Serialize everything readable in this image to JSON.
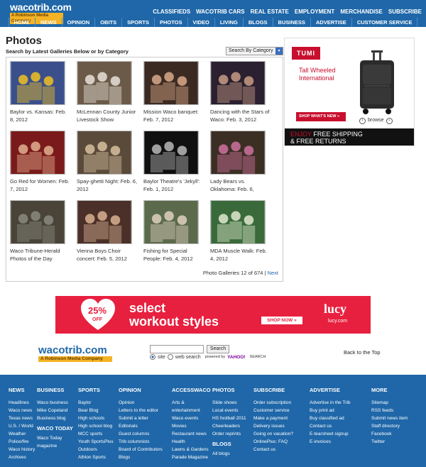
{
  "header": {
    "logo_text": "wacotrib.com",
    "logo_sub": "A Robinson Media Company",
    "top_links": [
      "CLASSIFIEDS",
      "WACOTRIB CARS",
      "REAL ESTATE",
      "EMPLOYMENT",
      "MERCHANDISE",
      "SUBSCRIBE"
    ],
    "nav": [
      "HOME",
      "NEWS",
      "OPINION",
      "OBITS",
      "SPORTS",
      "PHOTOS",
      "VIDEO",
      "LIVING",
      "BLOGS",
      "BUSINESS",
      "ADVERTISE",
      "CUSTOMER SERVICE"
    ]
  },
  "photos": {
    "title": "Photos",
    "subtitle": "Search by Latest Galleries Below or by Category",
    "category_select": "Search By Category",
    "galleries": [
      {
        "caption": "Baylor vs. Kansas: Feb. 8, 2012",
        "thumb_bg": "#3a4f8c",
        "thumb_fg": "#f0c020"
      },
      {
        "caption": "McLennan County Junior Livestock Show",
        "thumb_bg": "#6b5a48",
        "thumb_fg": "#e8e2da"
      },
      {
        "caption": "Mission Waco banquet: Feb. 7, 2012",
        "thumb_bg": "#3a2a22",
        "thumb_fg": "#d9a98a"
      },
      {
        "caption": "Dancing with the Stars of Waco: Feb. 3, 2012",
        "thumb_bg": "#2a2030",
        "thumb_fg": "#c89c84"
      },
      {
        "caption": "Go Red for Women: Feb. 7, 2012",
        "thumb_bg": "#7a1a1a",
        "thumb_fg": "#e0b090"
      },
      {
        "caption": "Spay-ghetti Night: Feb. 6, 2012",
        "thumb_bg": "#5a4a3a",
        "thumb_fg": "#d8c0a0"
      },
      {
        "caption": "Baylor Theatre's 'Jekyll': Feb. 1, 2012",
        "thumb_bg": "#101010",
        "thumb_fg": "#b8b8b8"
      },
      {
        "caption": "Lady Bears vs. Oklahoma: Feb. 6,",
        "thumb_bg": "#3b2f24",
        "thumb_fg": "#d070a0"
      },
      {
        "caption": "Waco Tribune-Herald Photos of the Day",
        "thumb_bg": "#4a4438",
        "thumb_fg": "#8a8a80"
      },
      {
        "caption": "Vienna Boys Choir concert: Feb. 5, 2012",
        "thumb_bg": "#4a3028",
        "thumb_fg": "#d8b090"
      },
      {
        "caption": "Fishing for Special People: Feb. 4, 2012",
        "thumb_bg": "#5a6a4a",
        "thumb_fg": "#e0d0c0"
      },
      {
        "caption": "MDA Muscle Walk: Feb. 4, 2012",
        "thumb_bg": "#3a6a3a",
        "thumb_fg": "#e0e8d0"
      }
    ],
    "count_text": "Photo Galleries 12 of 674 |",
    "next_label": "Next"
  },
  "ad_tumi": {
    "logo": "TUMI",
    "headline": "Tall Wheeled International",
    "button": "SHOP WHAT'S NEW »",
    "browse": "browse",
    "bar_enjoy": "ENJOY",
    "bar_line1": " FREE SHIPPING",
    "bar_line2": "& FREE RETURNS"
  },
  "ad_lucy": {
    "badge_pct": "25%",
    "badge_off": "OFF",
    "headline_1": "select",
    "headline_2": "workout styles",
    "button": "SHOP NOW »",
    "brand": "lucy",
    "url": "lucy.com"
  },
  "search": {
    "logo_text": "wacotrib.com",
    "logo_sub": "A Robinson Media Company",
    "button": "Search",
    "opt_site": "site",
    "opt_web": "web search",
    "powered": "powered by",
    "yahoo": "YAHOO!",
    "search_word": "SEARCH",
    "back_to_top": "Back to the Top"
  },
  "footer": {
    "columns": [
      {
        "heading": "NEWS",
        "links": [
          "Headlines",
          "Waco news",
          "Texas news",
          "U.S. / World",
          "Weather",
          "Police/fire",
          "Waco history",
          "Archives"
        ]
      },
      {
        "heading": "BUSINESS",
        "links": [
          "Waco business",
          "Mike Copeland",
          "Business blog"
        ],
        "heading2": "WACO TODAY",
        "links2": [
          "Waco Today",
          "magazine"
        ]
      },
      {
        "heading": "SPORTS",
        "links": [
          "Baylor",
          "Bear Blog",
          "High schools",
          "High school blog",
          "MCC sports",
          "Youth SportsPlus",
          "Outdoors",
          "Athlon Sports"
        ]
      },
      {
        "heading": "OPINION",
        "links": [
          "Opinion",
          "Letters to the editor",
          "Submit a letter",
          "Editorials",
          "Guest columns",
          "Trib columnists",
          "Board of Contributors",
          "Blogs"
        ]
      },
      {
        "heading": "ACCESSWACO",
        "links": [
          "Arts &",
          "entertainment",
          "Waco events",
          "Movies",
          "Restaurant news",
          "Health",
          "Lawns & Gardens",
          "Parade Magazine"
        ]
      },
      {
        "heading": "PHOTOS",
        "links": [
          "Slide shows",
          "Local events",
          "HS football 2011",
          "Cheerleaders",
          "Order reprints"
        ],
        "heading2": "BLOGS",
        "links2": [
          "All blogs"
        ]
      },
      {
        "heading": "SUBSCRIBE",
        "links": [
          "Order subscription",
          "Customer service",
          "Make a payment",
          "Delivery issues",
          "Going on vacation?",
          "OnlinePlus: FAQ",
          "Contact us"
        ]
      },
      {
        "heading": "ADVERTISE",
        "links": [
          "Advertise in the Trib",
          "Buy print ad",
          "Buy classified ad",
          "Contact us",
          "E-tearsheet signup",
          "E-invoices"
        ]
      },
      {
        "heading": "MORE",
        "links": [
          "Sitemap",
          "RSS feeds",
          "Submit news item",
          "Staff directory",
          "Facebook",
          "Twitter"
        ]
      }
    ]
  }
}
